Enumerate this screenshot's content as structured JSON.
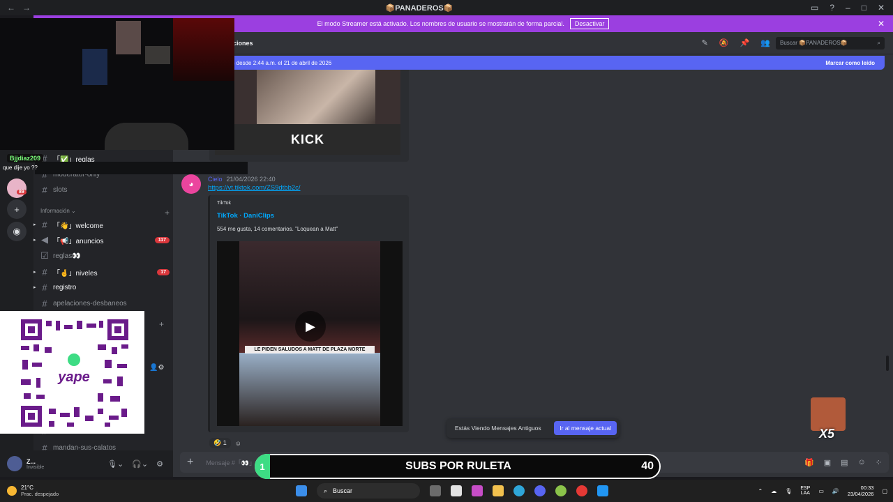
{
  "window": {
    "title": "📦PANADEROS📦"
  },
  "streamer_banner": {
    "text": "El modo Streamer está activado. Los nombres de usuario se mostrarán de forma parcial.",
    "button": "Desactivar"
  },
  "header": {
    "channel_name": "ciones",
    "search_placeholder": "Buscar 📦PANADEROS📦"
  },
  "new_messages_bar": {
    "text": "vos desde 2:44 a.m. el 21 de abril de 2026",
    "mark_read": "Marcar como leído"
  },
  "sidebar": {
    "channels_top": [
      {
        "name": "「✅」reglas"
      },
      {
        "name": "moderator-only"
      },
      {
        "name": "slots"
      }
    ],
    "category_info": "Información",
    "channels_info": [
      {
        "name": "「👋」welcome",
        "badge": ""
      },
      {
        "name": "「📢」anuncios",
        "badge": "117"
      },
      {
        "name": "reglas👀",
        "badge": ""
      },
      {
        "name": "「🤞」niveles",
        "badge": "17"
      },
      {
        "name": "registro",
        "badge": ""
      },
      {
        "name": "apelaciones-desbaneos",
        "badge": ""
      }
    ],
    "bottom_channel": "mandan-sus-calatos",
    "bottom_channel_2": "media",
    "rail_badge": "89"
  },
  "user_panel": {
    "name": "Z...",
    "status": "Invisible"
  },
  "chat_overlay": {
    "username": "Bjjdiaz209",
    "message": "que dije yo ??"
  },
  "kick_embed": {
    "label": "KICK"
  },
  "message": {
    "author": "Cielo",
    "timestamp": "21/04/2026 22:40",
    "link": "https://vt.tiktok.com/ZS9dtbb2c/",
    "embed": {
      "provider": "TikTok",
      "title": "TikTok · DaniClips",
      "description": "554 me gusta, 14 comentarios. \"Loquean a Matt\"",
      "caption": "LE PIDEN SALUDOS A MATT DE PLAZA NORTE"
    },
    "reactions": [
      {
        "emoji": "🤣",
        "count": "1"
      }
    ]
  },
  "old_messages": {
    "text": "Estás Viendo Mensajes Antiguos",
    "button": "Ir al mensaje actual"
  },
  "composer": {
    "placeholder": "Mensaje #「👀」reacciones"
  },
  "subs_overlay": {
    "label": "SUBS POR RULETA",
    "count": "40",
    "progress": "1"
  },
  "sticker": {
    "text": "X5"
  },
  "qr": {
    "brand": "yape"
  },
  "taskbar": {
    "temp": "21°C",
    "weather": "Prac. despejado",
    "search": "Buscar",
    "lang1": "ESP",
    "lang2": "LAA",
    "time": "00:33",
    "date": "23/04/2026"
  },
  "colors": {
    "accent": "#5865f2",
    "streamer": "#9b3fe0",
    "danger": "#da373c",
    "link": "#00a8fc"
  }
}
